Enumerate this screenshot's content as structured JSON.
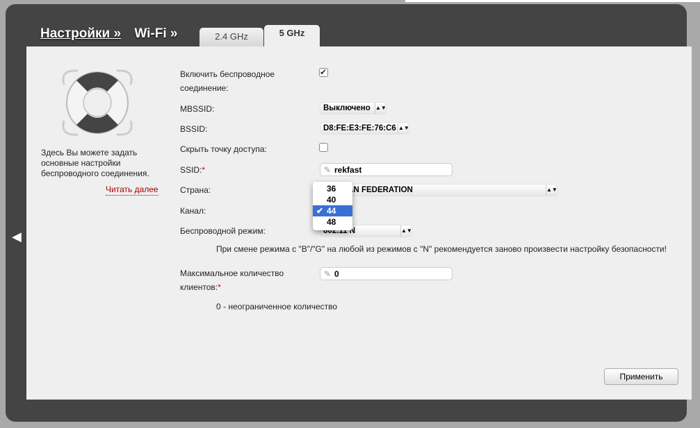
{
  "breadcrumb": {
    "settings": "Настройки »",
    "wifi": "Wi-Fi »"
  },
  "tabs": [
    {
      "label": "2.4 GHz"
    },
    {
      "label": "5 GHz",
      "active": true
    }
  ],
  "help": {
    "text": "Здесь Вы можете задать основные настройки беспроводного соединения.",
    "more": "Читать далее"
  },
  "form": {
    "enable_label": "Включить беспроводное соединение:",
    "enable_checked": true,
    "mbssid_label": "MBSSID:",
    "mbssid_value": "Выключено",
    "bssid_label": "BSSID:",
    "bssid_value": "D8:FE:E3:FE:76:C6",
    "hide_label": "Скрыть точку доступа:",
    "hide_checked": false,
    "ssid_label": "SSID:",
    "ssid_value": "rekfast",
    "country_label": "Страна:",
    "country_value": "RUSSIAN FEDERATION",
    "channel_label": "Канал:",
    "channel_options": [
      "36",
      "40",
      "44",
      "48"
    ],
    "channel_selected": "44",
    "mode_label": "Беспроводной режим:",
    "mode_value": "802.11 N",
    "mode_note": "При смене режима с \"B\"/\"G\" на любой из режимов с \"N\" рекомендуется заново произвести настройку безопасности!",
    "maxclients_label": "Максимальное количество клиентов:",
    "maxclients_value": "0",
    "maxclients_note": "0 - неограниченное количество",
    "required_mark": "*"
  },
  "apply_label": "Применить",
  "check_mark": "✔"
}
